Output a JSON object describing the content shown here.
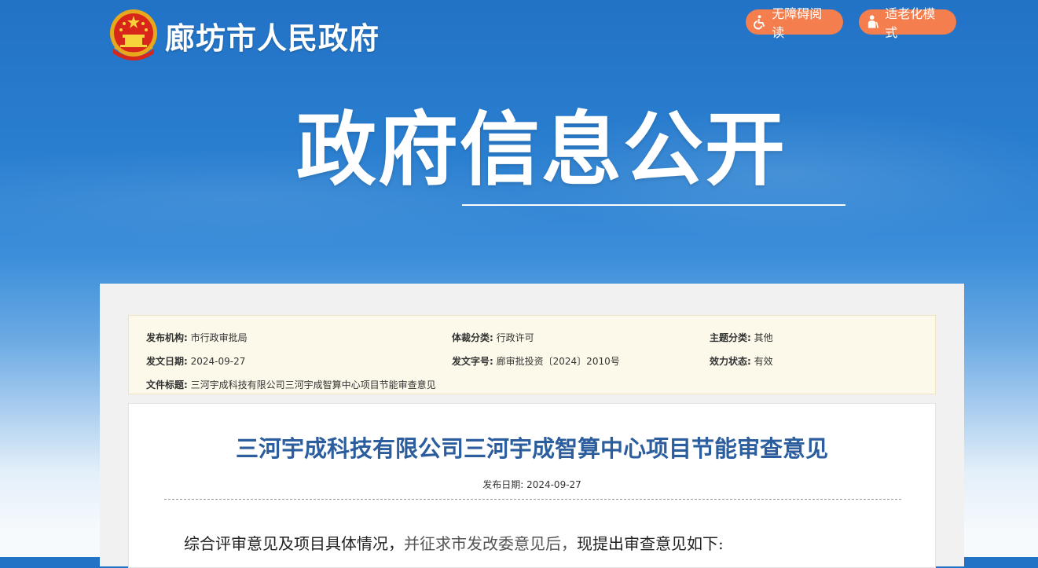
{
  "header": {
    "site_title": "廊坊市人民政府",
    "accessibility_label": "无障碍阅读",
    "elder_mode_label": "适老化模式",
    "banner_title": "政府信息公开"
  },
  "meta": {
    "publisher_label": "发布机构:",
    "publisher": "市行政审批局",
    "genre_label": "体裁分类:",
    "genre": "行政许可",
    "topic_label": "主题分类:",
    "topic": "其他",
    "issue_date_label": "发文日期:",
    "issue_date": "2024-09-27",
    "doc_no_label": "发文字号:",
    "doc_no": "廊审批投资〔2024〕2010号",
    "status_label": "效力状态:",
    "status": "有效",
    "file_title_label": "文件标题:",
    "file_title": "三河宇成科技有限公司三河宇成智算中心项目节能审查意见"
  },
  "article": {
    "title": "三河宇成科技有限公司三河宇成智算中心项目节能审查意见",
    "date_label": "发布日期:",
    "date": "2024-09-27",
    "body_part1": "综合评审意见及项目具体情况，",
    "body_part2": "并征求市发改委意见后，",
    "body_part3": "现提出审查意见如下:"
  },
  "colors": {
    "button_orange": "#f47e4e",
    "title_blue": "#2c5e9e",
    "banner_blue": "#2272c6"
  }
}
